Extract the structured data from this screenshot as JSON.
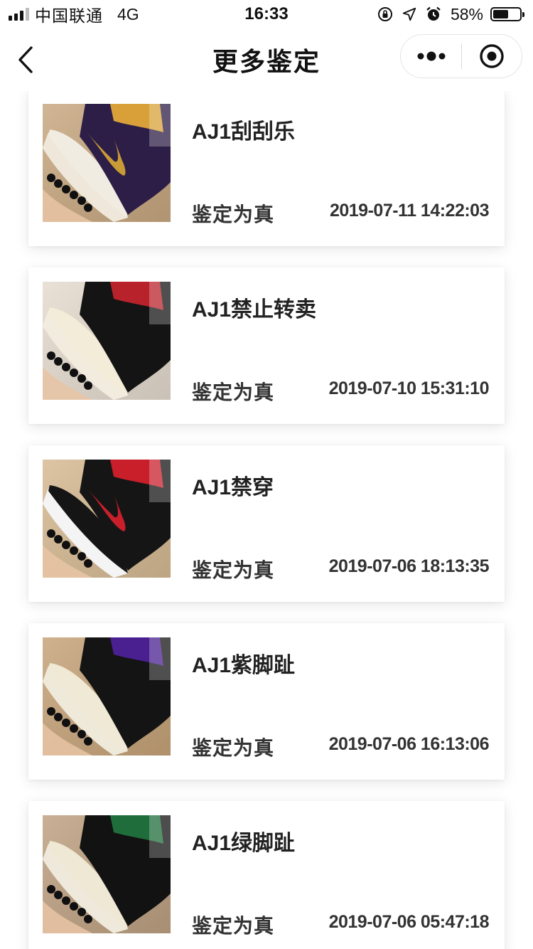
{
  "status_bar": {
    "carrier": "中国联通",
    "network": "4G",
    "time": "16:33",
    "battery_percent_text": "58%",
    "battery_level": 0.58,
    "icons": [
      "orientation-lock-icon",
      "location-arrow-icon",
      "alarm-clock-icon"
    ]
  },
  "nav": {
    "title": "更多鉴定",
    "back_icon": "chevron-left-icon",
    "more_icon": "more-dots-icon",
    "close_icon": "target-circle-icon"
  },
  "records": [
    {
      "title": "AJ1刮刮乐",
      "result": "鉴定为真",
      "date": "2019-07-11 14:22:03",
      "colors": {
        "bg": "#c9a982",
        "upper": "#2c1e46",
        "swoosh": "#c89b37",
        "toe": "#f1ece2",
        "collar": "#d9a03a",
        "sole": "#efe8da"
      }
    },
    {
      "title": "AJ1禁止转卖",
      "result": "鉴定为真",
      "date": "2019-07-10 15:31:10",
      "colors": {
        "bg": "#e6dccf",
        "upper": "#141414",
        "swoosh": "#141414",
        "toe": "#f3ecd9",
        "collar": "#b8232b",
        "sole": "#f2ecdf"
      }
    },
    {
      "title": "AJ1禁穿",
      "result": "鉴定为真",
      "date": "2019-07-06 18:13:35",
      "colors": {
        "bg": "#d7bb94",
        "upper": "#151515",
        "swoosh": "#c81f2a",
        "toe": "#151515",
        "collar": "#c81f2a",
        "sole": "#f4f4f4"
      }
    },
    {
      "title": "AJ1紫脚趾",
      "result": "鉴定为真",
      "date": "2019-07-06 16:13:06",
      "colors": {
        "bg": "#c7a47a",
        "upper": "#141414",
        "swoosh": "#141414",
        "toe": "#f0e9d6",
        "collar": "#4a1f8f",
        "sole": "#efe9da"
      }
    },
    {
      "title": "AJ1绿脚趾",
      "result": "鉴定为真",
      "date": "2019-07-06 05:47:18",
      "colors": {
        "bg": "#bfa283",
        "upper": "#121212",
        "swoosh": "#121212",
        "toe": "#efe8d5",
        "collar": "#1f6d3a",
        "sole": "#efe9dc"
      }
    }
  ]
}
